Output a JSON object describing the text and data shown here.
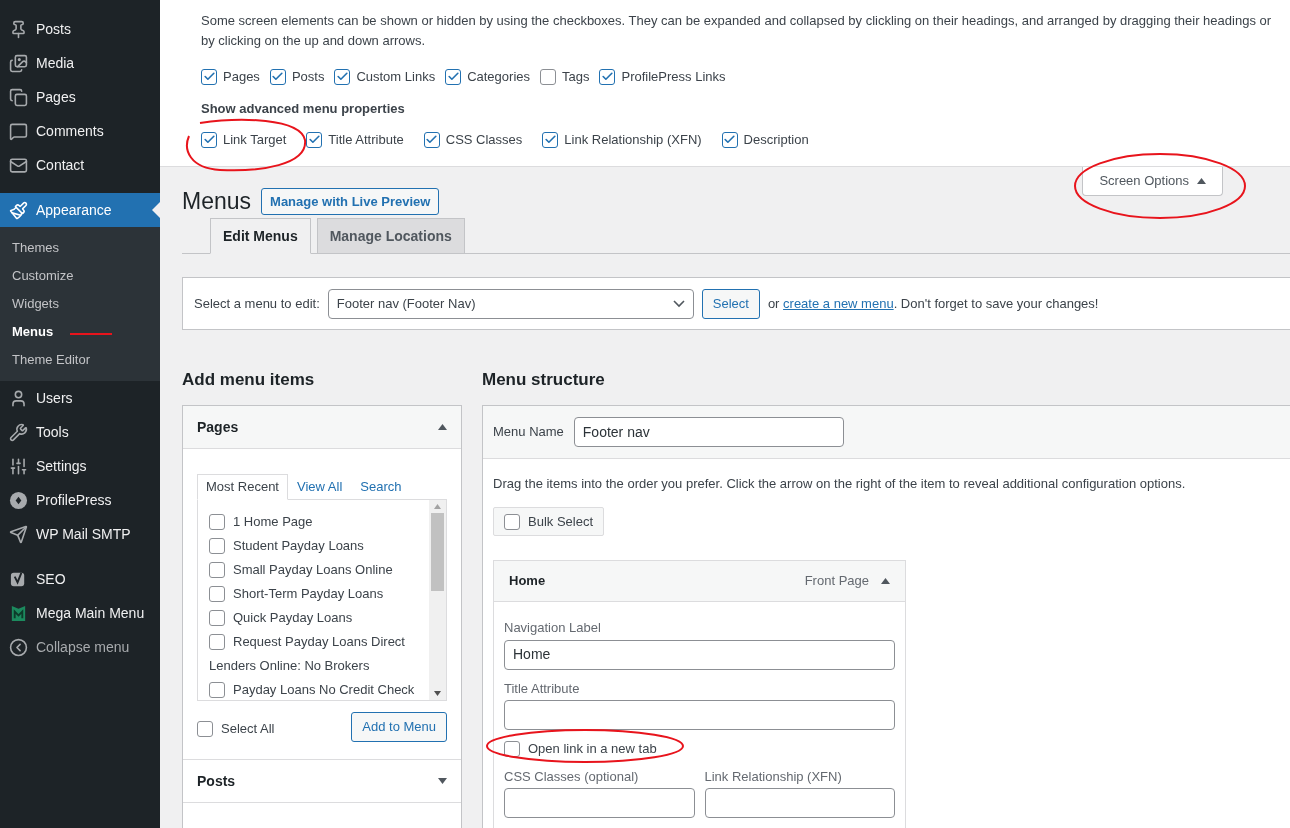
{
  "sidebar": {
    "items": [
      {
        "label": "Posts",
        "selected": false
      },
      {
        "label": "Media",
        "selected": false
      },
      {
        "label": "Pages",
        "selected": false
      },
      {
        "label": "Comments",
        "selected": false
      },
      {
        "label": "Contact",
        "selected": false
      },
      {
        "label": "Appearance",
        "selected": true,
        "children": [
          {
            "label": "Themes",
            "selected": false
          },
          {
            "label": "Customize",
            "selected": false
          },
          {
            "label": "Widgets",
            "selected": false
          },
          {
            "label": "Menus",
            "selected": true
          },
          {
            "label": "Theme Editor",
            "selected": false
          }
        ]
      },
      {
        "label": "Users",
        "selected": false
      },
      {
        "label": "Tools",
        "selected": false
      },
      {
        "label": "Settings",
        "selected": false
      },
      {
        "label": "ProfilePress",
        "selected": false
      },
      {
        "label": "WP Mail SMTP",
        "selected": false
      },
      {
        "label": "SEO",
        "selected": false
      },
      {
        "label": "Mega Main Menu",
        "selected": false
      },
      {
        "label": "Collapse menu",
        "selected": false
      }
    ]
  },
  "screen_options": {
    "description": "Some screen elements can be shown or hidden by using the checkboxes. They can be expanded and collapsed by clickling on their headings, and arranged by dragging their headings or by clicking on the up and down arrows.",
    "boxes": [
      {
        "label": "Pages",
        "checked": true
      },
      {
        "label": "Posts",
        "checked": true
      },
      {
        "label": "Custom Links",
        "checked": true
      },
      {
        "label": "Categories",
        "checked": true
      },
      {
        "label": "Tags",
        "checked": false
      },
      {
        "label": "ProfilePress Links",
        "checked": true
      }
    ],
    "advanced_heading": "Show advanced menu properties",
    "advanced": [
      {
        "label": "Link Target",
        "checked": true
      },
      {
        "label": "Title Attribute",
        "checked": true
      },
      {
        "label": "CSS Classes",
        "checked": true
      },
      {
        "label": "Link Relationship (XFN)",
        "checked": true
      },
      {
        "label": "Description",
        "checked": true
      }
    ],
    "toggle_label": "Screen Options",
    "expanded": true
  },
  "page": {
    "title": "Menus",
    "live_preview_button": "Manage with Live Preview",
    "tabs": [
      {
        "label": "Edit Menus",
        "selected": true
      },
      {
        "label": "Manage Locations",
        "selected": false
      }
    ]
  },
  "select_menu": {
    "label": "Select a menu to edit:",
    "value": "Footer nav (Footer Nav)",
    "button": "Select",
    "text_before": "or ",
    "link": "create a new menu",
    "text_after": ". Don't forget to save your changes!"
  },
  "add_items": {
    "heading": "Add menu items",
    "pages_box": {
      "title": "Pages",
      "expanded": true,
      "tabs": [
        {
          "label": "Most Recent",
          "selected": true
        },
        {
          "label": "View All",
          "selected": false
        },
        {
          "label": "Search",
          "selected": false
        }
      ],
      "items": [
        {
          "kind": "checkbox",
          "label": "1 Home Page",
          "checked": false
        },
        {
          "kind": "checkbox",
          "label": "Student Payday Loans",
          "checked": false
        },
        {
          "kind": "checkbox",
          "label": "Small Payday Loans Online",
          "checked": false
        },
        {
          "kind": "checkbox",
          "label": "Short-Term Payday Loans",
          "checked": false
        },
        {
          "kind": "checkbox",
          "label": "Quick Payday Loans",
          "checked": false
        },
        {
          "kind": "checkbox",
          "label": "Request Payday Loans Direct",
          "checked": false
        },
        {
          "kind": "text",
          "label": "Lenders Online: No Brokers"
        },
        {
          "kind": "checkbox",
          "label": "Payday Loans No Credit Check",
          "checked": false
        }
      ],
      "select_all": {
        "label": "Select All",
        "checked": false
      },
      "add_button": "Add to Menu"
    },
    "posts_box": {
      "title": "Posts",
      "expanded": false
    }
  },
  "menu_structure": {
    "heading": "Menu structure",
    "menu_name_label": "Menu Name",
    "menu_name_value": "Footer nav",
    "instructions": "Drag the items into the order you prefer. Click the arrow on the right of the item to reveal additional configuration options.",
    "bulk_select": {
      "label": "Bulk Select",
      "checked": false
    },
    "item": {
      "title": "Home",
      "type": "Front Page",
      "expanded": true,
      "navigation_label": "Navigation Label",
      "navigation_value": "Home",
      "title_attribute_label": "Title Attribute",
      "new_tab": {
        "label": "Open link in a new tab",
        "checked": false
      },
      "css_classes_label": "CSS Classes (optional)",
      "xfn_label": "Link Relationship (XFN)"
    }
  }
}
